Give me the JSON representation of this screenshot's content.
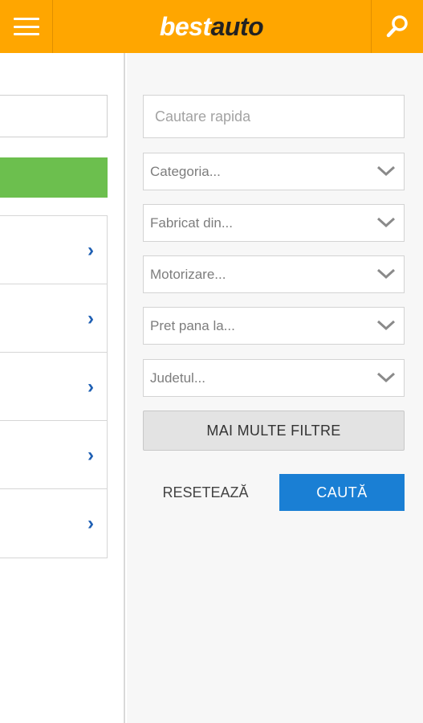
{
  "header": {
    "brand_part1": "best",
    "brand_part2": "auto",
    "menu_icon": "hamburger-icon",
    "search_icon": "search-icon",
    "bg_color": "#ffa600"
  },
  "left_panel": {
    "rows": [
      {
        "icon": "chevron-right-icon"
      },
      {
        "icon": "chevron-right-icon"
      },
      {
        "icon": "chevron-right-icon"
      },
      {
        "icon": "chevron-right-icon"
      },
      {
        "icon": "chevron-right-icon"
      }
    ],
    "accent_color": "#6cbf4e"
  },
  "filters": {
    "search_placeholder": "Cautare rapida",
    "selects": [
      {
        "value": "Categoria..."
      },
      {
        "value": "Fabricat din..."
      },
      {
        "value": "Motorizare..."
      },
      {
        "value": "Pret pana la..."
      },
      {
        "value": "Judetul..."
      }
    ],
    "more_filters_label": "MAI MULTE FILTRE",
    "reset_label": "RESETEAZĂ",
    "submit_label": "CAUTĂ",
    "submit_color": "#1a7fd4"
  }
}
